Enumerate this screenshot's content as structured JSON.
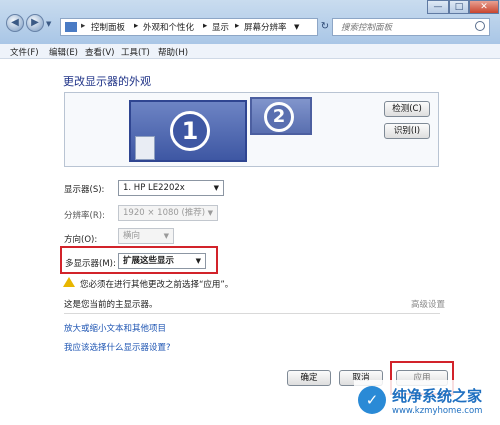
{
  "window": {
    "minimize": "—",
    "maximize": "□",
    "close": "✕"
  },
  "nav": {
    "back": "◀",
    "forward": "▶",
    "breadcrumb": [
      "控制面板",
      "外观和个性化",
      "显示",
      "屏幕分辨率"
    ],
    "separator": "▸",
    "refresh": "↻",
    "search_placeholder": "搜索控制面板"
  },
  "menu": [
    "文件(F)",
    "编辑(E)",
    "查看(V)",
    "工具(T)",
    "帮助(H)"
  ],
  "page": {
    "heading": "更改显示器的外观",
    "monitors": [
      {
        "number": "1"
      },
      {
        "number": "2"
      }
    ],
    "detect_button": "检测(C)",
    "identify_button": "识别(I)",
    "display_label": "显示器(S):",
    "display_value": "1. HP LE2202x",
    "resolution_label": "分辨率(R):",
    "resolution_value": "1920 × 1080 (推荐)",
    "orientation_label": "方向(O):",
    "orientation_value": "横向",
    "multi_label": "多显示器(M):",
    "multi_value": "扩展这些显示",
    "warning_text": "您必须在进行其他更改之前选择“应用”。",
    "primary_text": "这是您当前的主显示器。",
    "advanced_link": "高级设置",
    "link1": "放大或缩小文本和其他项目",
    "link2": "我应该选择什么显示器设置?",
    "ok_button": "确定",
    "cancel_button": "取消",
    "apply_button": "应用"
  },
  "watermark": {
    "title": "纯净系统之家",
    "url": "www.kzmyhome.com"
  },
  "colors": {
    "highlight": "#d2232a",
    "link": "#1f56b3",
    "heading": "#1e3287"
  }
}
